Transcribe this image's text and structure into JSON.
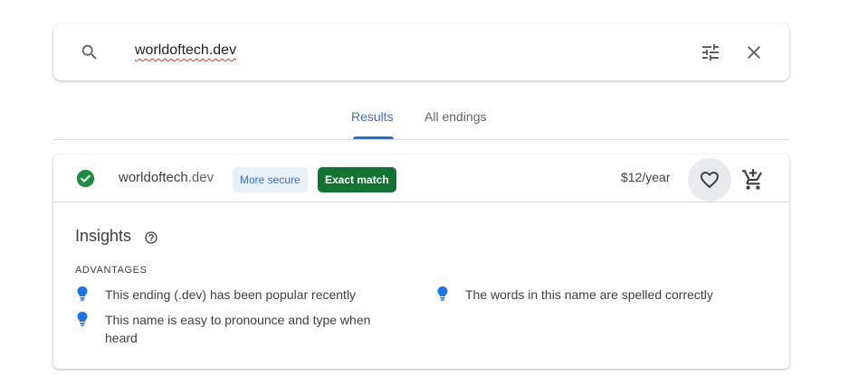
{
  "search": {
    "query": "worldoftech.dev"
  },
  "tabs": [
    {
      "label": "Results",
      "active": true
    },
    {
      "label": "All endings",
      "active": false
    }
  ],
  "result": {
    "domain_base": "worldoftech",
    "domain_tld": ".dev",
    "badges": {
      "secure": "More secure",
      "exact": "Exact match"
    },
    "price": "$12/year"
  },
  "insights": {
    "title": "Insights",
    "advantages_heading": "ADVANTAGES",
    "advantages": [
      "This ending (.dev) has been popular recently",
      "This name is easy to pronounce and type when heard",
      "The words in this name are spelled correctly"
    ]
  },
  "colors": {
    "accent": "#1a73e8",
    "success": "#1e8e3e",
    "exact_badge": "#137333"
  }
}
